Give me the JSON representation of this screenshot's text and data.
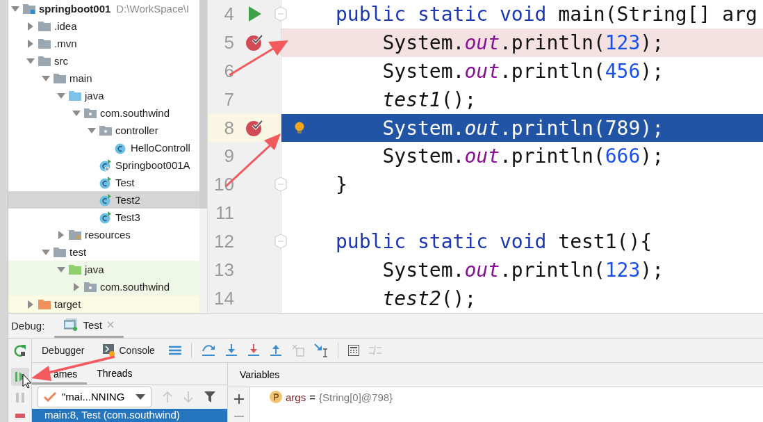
{
  "project_tree": {
    "items": [
      {
        "label": "springboot001",
        "detail": "D:\\WorkSpace\\I",
        "kind": "module",
        "expanded": true,
        "selected": false,
        "children": [
          {
            "label": ".idea",
            "kind": "folder",
            "expanded": false,
            "selected": false
          },
          {
            "label": ".mvn",
            "kind": "folder",
            "expanded": false,
            "selected": false
          },
          {
            "label": "src",
            "kind": "folder",
            "expanded": true,
            "selected": false,
            "children": [
              {
                "label": "main",
                "kind": "folder",
                "expanded": true,
                "selected": false,
                "children": [
                  {
                    "label": "java",
                    "kind": "source",
                    "expanded": true,
                    "selected": false,
                    "children": [
                      {
                        "label": "com.southwind",
                        "kind": "package",
                        "expanded": true,
                        "selected": false,
                        "children": [
                          {
                            "label": "controller",
                            "kind": "package",
                            "expanded": true,
                            "selected": false,
                            "children": [
                              {
                                "label": "HelloControll",
                                "kind": "class",
                                "selected": false
                              }
                            ]
                          },
                          {
                            "label": "Springboot001A",
                            "kind": "spring-app",
                            "selected": false
                          },
                          {
                            "label": "Test",
                            "kind": "runnable-class",
                            "selected": false
                          },
                          {
                            "label": "Test2",
                            "kind": "runnable-class",
                            "selected": true
                          },
                          {
                            "label": "Test3",
                            "kind": "runnable-class",
                            "selected": false
                          }
                        ]
                      }
                    ]
                  },
                  {
                    "label": "resources",
                    "kind": "resources",
                    "expanded": false,
                    "selected": false
                  }
                ]
              },
              {
                "label": "test",
                "kind": "folder",
                "expanded": true,
                "selected": false,
                "children": [
                  {
                    "label": "java",
                    "kind": "test-source",
                    "test_scope": true,
                    "expanded": true,
                    "selected": false,
                    "children": [
                      {
                        "label": "com.southwind",
                        "kind": "package",
                        "test_scope": true,
                        "expanded": false,
                        "selected": false
                      }
                    ]
                  }
                ]
              }
            ]
          },
          {
            "label": "target",
            "kind": "excluded",
            "excluded": true,
            "expanded": false,
            "selected": false
          }
        ]
      }
    ]
  },
  "editor": {
    "lines": [
      {
        "number": "4",
        "run": true,
        "fold": true,
        "breakpoint": false,
        "current": false,
        "tokens": [
          {
            "kind": "keyword",
            "text": "public static void"
          },
          {
            "kind": "plain",
            "text": " main(String[] arg"
          }
        ]
      },
      {
        "number": "5",
        "breakpoint": true,
        "current": false,
        "tokens": [
          {
            "kind": "plain",
            "text": "    System."
          },
          {
            "kind": "field",
            "text": "out"
          },
          {
            "kind": "plain",
            "text": ".println("
          },
          {
            "kind": "number",
            "text": "123"
          },
          {
            "kind": "plain",
            "text": ");"
          }
        ]
      },
      {
        "number": "6",
        "breakpoint": false,
        "current": false,
        "tokens": [
          {
            "kind": "plain",
            "text": "    System."
          },
          {
            "kind": "field",
            "text": "out"
          },
          {
            "kind": "plain",
            "text": ".println("
          },
          {
            "kind": "number",
            "text": "456"
          },
          {
            "kind": "plain",
            "text": ");"
          }
        ]
      },
      {
        "number": "7",
        "breakpoint": false,
        "current": false,
        "tokens": [
          {
            "kind": "call",
            "text": "    test1"
          },
          {
            "kind": "plain",
            "text": "();"
          }
        ]
      },
      {
        "number": "8",
        "breakpoint": true,
        "current": true,
        "bulb": true,
        "tokens": [
          {
            "kind": "plain",
            "text": "    System."
          },
          {
            "kind": "field",
            "text": "out"
          },
          {
            "kind": "plain",
            "text": ".println("
          },
          {
            "kind": "number",
            "text": "789"
          },
          {
            "kind": "plain",
            "text": ");"
          }
        ]
      },
      {
        "number": "9",
        "breakpoint": false,
        "current": false,
        "tokens": [
          {
            "kind": "plain",
            "text": "    System."
          },
          {
            "kind": "field",
            "text": "out"
          },
          {
            "kind": "plain",
            "text": ".println("
          },
          {
            "kind": "number",
            "text": "666"
          },
          {
            "kind": "plain",
            "text": ");"
          }
        ]
      },
      {
        "number": "10",
        "fold": true,
        "breakpoint": false,
        "current": false,
        "tokens": [
          {
            "kind": "plain",
            "text": "}"
          }
        ]
      },
      {
        "number": "11",
        "breakpoint": false,
        "current": false
      },
      {
        "number": "12",
        "fold": true,
        "breakpoint": false,
        "current": false,
        "tokens": [
          {
            "kind": "keyword",
            "text": "public static void"
          },
          {
            "kind": "plain",
            "text": " test1(){"
          }
        ]
      },
      {
        "number": "13",
        "breakpoint": false,
        "current": false,
        "tokens": [
          {
            "kind": "plain",
            "text": "    System."
          },
          {
            "kind": "field",
            "text": "out"
          },
          {
            "kind": "plain",
            "text": ".println("
          },
          {
            "kind": "number",
            "text": "123"
          },
          {
            "kind": "plain",
            "text": ");"
          }
        ]
      },
      {
        "number": "14",
        "breakpoint": false,
        "current": false,
        "tokens": [
          {
            "kind": "call",
            "text": "    test2"
          },
          {
            "kind": "plain",
            "text": "();"
          }
        ]
      }
    ]
  },
  "debug": {
    "label": "Debug:",
    "tabs": [
      {
        "label": "Test",
        "selected": true
      }
    ],
    "views": [
      {
        "label": "Debugger",
        "kind": "debugger"
      },
      {
        "label": "Console",
        "kind": "console"
      }
    ],
    "frame_tabs": [
      {
        "label": "ames",
        "selected": true
      },
      {
        "label": "Threads",
        "selected": false
      }
    ],
    "thread": {
      "value": "\"mai...NNING"
    },
    "frames": [
      {
        "label": "main:8, Test (com.southwind)",
        "selected": true
      }
    ],
    "variables": {
      "title": "Variables",
      "items": [
        {
          "name": "args",
          "equals": "=",
          "value": "{String[0]@798}"
        }
      ]
    }
  }
}
